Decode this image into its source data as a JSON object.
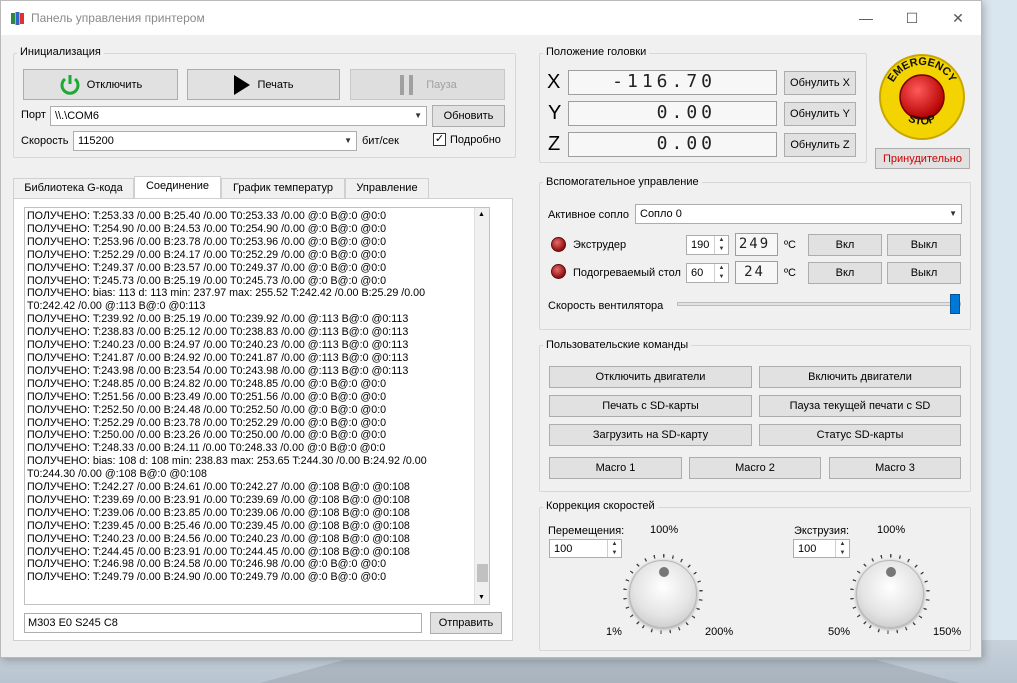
{
  "window": {
    "title": "Панель управления принтером"
  },
  "init": {
    "group_title": "Инициализация",
    "disconnect_label": "Отключить",
    "print_label": "Печать",
    "pause_label": "Пауза",
    "port_label": "Порт",
    "port_value": "\\\\.\\COM6",
    "refresh_label": "Обновить",
    "speed_label": "Скорость",
    "speed_value": "115200",
    "speed_unit": "бит/сек",
    "verbose_label": "Подробно",
    "verbose_checked": true
  },
  "tabs": [
    {
      "label": "Библиотека G-кода",
      "active": false
    },
    {
      "label": "Соединение",
      "active": true
    },
    {
      "label": "График температур",
      "active": false
    },
    {
      "label": "Управление",
      "active": false
    }
  ],
  "log": [
    "ПОЛУЧЕНО:  T:253.33 /0.00 B:25.40 /0.00 T0:253.33 /0.00 @:0 B@:0 @0:0",
    "ПОЛУЧЕНО:  T:254.90 /0.00 B:24.53 /0.00 T0:254.90 /0.00 @:0 B@:0 @0:0",
    "ПОЛУЧЕНО:  T:253.96 /0.00 B:23.78 /0.00 T0:253.96 /0.00 @:0 B@:0 @0:0",
    "ПОЛУЧЕНО:  T:252.29 /0.00 B:24.17 /0.00 T0:252.29 /0.00 @:0 B@:0 @0:0",
    "ПОЛУЧЕНО:  T:249.37 /0.00 B:23.57 /0.00 T0:249.37 /0.00 @:0 B@:0 @0:0",
    "ПОЛУЧЕНО:  T:245.73 /0.00 B:25.19 /0.00 T0:245.73 /0.00 @:0 B@:0 @0:0",
    "ПОЛУЧЕНО:  bias: 113 d: 113 min: 237.97 max: 255.52 T:242.42 /0.00 B:25.29 /0.00",
    "T0:242.42 /0.00 @:113 B@:0 @0:113",
    "ПОЛУЧЕНО:  T:239.92 /0.00 B:25.19 /0.00 T0:239.92 /0.00 @:113 B@:0 @0:113",
    "ПОЛУЧЕНО:  T:238.83 /0.00 B:25.12 /0.00 T0:238.83 /0.00 @:113 B@:0 @0:113",
    "ПОЛУЧЕНО:  T:240.23 /0.00 B:24.97 /0.00 T0:240.23 /0.00 @:113 B@:0 @0:113",
    "ПОЛУЧЕНО:  T:241.87 /0.00 B:24.92 /0.00 T0:241.87 /0.00 @:113 B@:0 @0:113",
    "ПОЛУЧЕНО:  T:243.98 /0.00 B:23.54 /0.00 T0:243.98 /0.00 @:113 B@:0 @0:113",
    "ПОЛУЧЕНО:  T:248.85 /0.00 B:24.82 /0.00 T0:248.85 /0.00 @:0 B@:0 @0:0",
    "ПОЛУЧЕНО:  T:251.56 /0.00 B:23.49 /0.00 T0:251.56 /0.00 @:0 B@:0 @0:0",
    "ПОЛУЧЕНО:  T:252.50 /0.00 B:24.48 /0.00 T0:252.50 /0.00 @:0 B@:0 @0:0",
    "ПОЛУЧЕНО:  T:252.29 /0.00 B:23.78 /0.00 T0:252.29 /0.00 @:0 B@:0 @0:0",
    "ПОЛУЧЕНО:  T:250.00 /0.00 B:23.26 /0.00 T0:250.00 /0.00 @:0 B@:0 @0:0",
    "ПОЛУЧЕНО:  T:248.33 /0.00 B:24.11 /0.00 T0:248.33 /0.00 @:0 B@:0 @0:0",
    "ПОЛУЧЕНО:  bias: 108 d: 108 min: 238.83 max: 253.65 T:244.30 /0.00 B:24.92 /0.00",
    "T0:244.30 /0.00 @:108 B@:0 @0:108",
    "ПОЛУЧЕНО:  T:242.27 /0.00 B:24.61 /0.00 T0:242.27 /0.00 @:108 B@:0 @0:108",
    "ПОЛУЧЕНО:  T:239.69 /0.00 B:23.91 /0.00 T0:239.69 /0.00 @:108 B@:0 @0:108",
    "ПОЛУЧЕНО:  T:239.06 /0.00 B:23.85 /0.00 T0:239.06 /0.00 @:108 B@:0 @0:108",
    "ПОЛУЧЕНО:  T:239.45 /0.00 B:25.46 /0.00 T0:239.45 /0.00 @:108 B@:0 @0:108",
    "ПОЛУЧЕНО:  T:240.23 /0.00 B:24.56 /0.00 T0:240.23 /0.00 @:108 B@:0 @0:108",
    "ПОЛУЧЕНО:  T:244.45 /0.00 B:23.91 /0.00 T0:244.45 /0.00 @:108 B@:0 @0:108",
    "ПОЛУЧЕНО:  T:246.98 /0.00 B:24.58 /0.00 T0:246.98 /0.00 @:0 B@:0 @0:0",
    "ПОЛУЧЕНО:  T:249.79 /0.00 B:24.90 /0.00 T0:249.79 /0.00 @:0 B@:0 @0:0"
  ],
  "command": {
    "value": "M303 E0 S245 C8",
    "send_label": "Отправить"
  },
  "head": {
    "group_title": "Положение головки",
    "x_label": "X",
    "x_value": "-116.70",
    "x_reset": "Обнулить X",
    "y_label": "Y",
    "y_value": "0.00",
    "y_reset": "Обнулить Y",
    "z_label": "Z",
    "z_value": "0.00",
    "z_reset": "Обнулить Z"
  },
  "emergency": {
    "stop_text_top": "EMERGENCY",
    "stop_text_bottom": "STOP",
    "force_label": "Принудительно",
    "force_color": "#cc0000"
  },
  "aux": {
    "group_title": "Вспомогательное управление",
    "active_nozzle_label": "Активное сопло",
    "active_nozzle_value": "Сопло 0",
    "extruder_label": "Экструдер",
    "extruder_target": "190",
    "extruder_current": "249",
    "bed_label": "Подогреваемый стол",
    "bed_target": "60",
    "bed_current": "24",
    "unit": "ºС",
    "on_label": "Вкл",
    "off_label": "Выкл",
    "fan_label": "Скорость вентилятора",
    "fan_level": 1.0
  },
  "custom": {
    "group_title": "Пользовательские команды",
    "motors_off": "Отключить двигатели",
    "motors_on": "Включить двигатели",
    "print_sd": "Печать с SD-карты",
    "pause_sd": "Пауза текущей печати с SD",
    "upload_sd": "Загрузить на SD-карту",
    "sd_status": "Статус SD-карты",
    "macro1": "Macro 1",
    "macro2": "Macro 2",
    "macro3": "Macro 3"
  },
  "speed": {
    "group_title": "Коррекция скоростей",
    "move_label": "Перемещения:",
    "move_value": "100",
    "move_top": "100%",
    "move_min": "1%",
    "move_max": "200%",
    "extr_label": "Экструзия:",
    "extr_value": "100",
    "extr_top": "100%",
    "extr_min": "50%",
    "extr_max": "150%"
  }
}
